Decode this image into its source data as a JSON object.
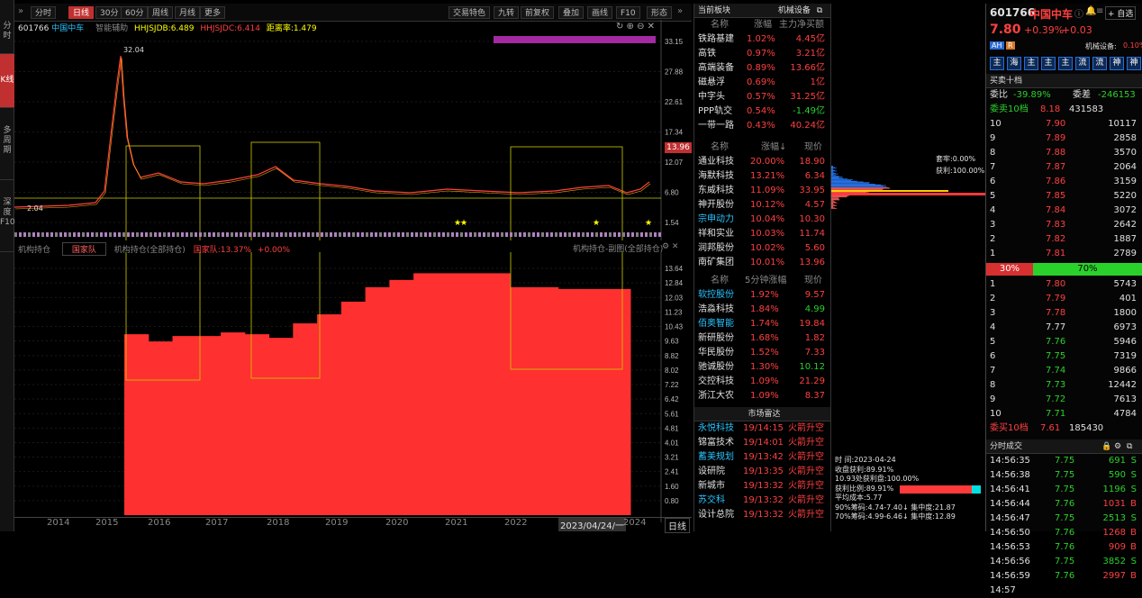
{
  "left_tabs": [
    "分时",
    "K线",
    "多周期",
    "深度F10"
  ],
  "toolbar": {
    "buttons": [
      "分时",
      "日线",
      "30分",
      "60分",
      "周线",
      "月线",
      "更多"
    ],
    "right_buttons": [
      "交易特色",
      "九转",
      "前复权",
      "叠加",
      "画线",
      "F10",
      "形态"
    ]
  },
  "chart": {
    "code": "601766",
    "name": "中国中车",
    "indicator": "智能辅助",
    "hhjsjdb": "HHJSJDB:6.489",
    "hhjsjdc": "HHJSJDC:6.414",
    "distance": "距离率:1.479",
    "price_axis": [
      "33.15",
      "27.88",
      "22.61",
      "17.34",
      "12.07",
      "6.80",
      "1.54"
    ],
    "current_price_tag": "13.96",
    "high_label": "32.04",
    "low_label": "2.04",
    "sub_title": "机构持仓",
    "sub_select": "国家队",
    "sub_indicator": "机构持仓(全部持仓)",
    "sub_value": "国家队:13.37%",
    "sub_change": "+0.00%",
    "sub_right": "机构持仓-副图(全部持仓)",
    "sub_axis": [
      "13.64",
      "12.84",
      "12.03",
      "11.23",
      "10.43",
      "9.63",
      "8.82",
      "8.02",
      "7.22",
      "6.42",
      "5.61",
      "4.81",
      "4.01",
      "3.21",
      "2.41",
      "1.60",
      "0.80"
    ],
    "x_years": [
      "2014",
      "2015",
      "2016",
      "2017",
      "2018",
      "2019",
      "2020",
      "2021",
      "2022",
      "2023/04/24/一",
      "2024"
    ],
    "period_button": "日线"
  },
  "chart_data": {
    "type": "bar",
    "title": "机构持仓",
    "series": [
      {
        "name": "国家队",
        "values": [
          10.0,
          9.6,
          9.9,
          9.9,
          10.1,
          10.0,
          9.8,
          10.6,
          11.1,
          11.8,
          12.6,
          13.0,
          13.37,
          13.37,
          13.37,
          13.37,
          12.6,
          12.6,
          12.5,
          12.5,
          12.5
        ]
      }
    ],
    "ylim": [
      0,
      13.64
    ]
  },
  "sector": {
    "title": "当前板块",
    "related": "机械设备",
    "headers": [
      "名称",
      "涨幅",
      "主力净买额"
    ],
    "rows": [
      {
        "name": "铁路基建",
        "pct": "1.02%",
        "net": "4.45亿"
      },
      {
        "name": "高铁",
        "pct": "0.97%",
        "net": "3.21亿"
      },
      {
        "name": "高端装备",
        "pct": "0.89%",
        "net": "13.66亿"
      },
      {
        "name": "磁悬浮",
        "pct": "0.69%",
        "net": "1亿"
      },
      {
        "name": "中字头",
        "pct": "0.57%",
        "net": "31.25亿"
      },
      {
        "name": "PPP轨交",
        "pct": "0.54%",
        "net": "-1.49亿"
      },
      {
        "name": "一带一路",
        "pct": "0.43%",
        "net": "40.24亿"
      }
    ]
  },
  "gainers": {
    "headers": [
      "名称",
      "涨幅↓",
      "现价"
    ],
    "rows": [
      {
        "name": "通业科技",
        "pct": "20.00%",
        "price": "18.90"
      },
      {
        "name": "海默科技",
        "pct": "13.21%",
        "price": "6.34"
      },
      {
        "name": "东威科技",
        "pct": "11.09%",
        "price": "33.95"
      },
      {
        "name": "神开股份",
        "pct": "10.12%",
        "price": "4.57"
      },
      {
        "name": "宗申动力",
        "pct": "10.04%",
        "price": "10.30"
      },
      {
        "name": "祥和实业",
        "pct": "10.03%",
        "price": "11.74"
      },
      {
        "name": "润邦股份",
        "pct": "10.02%",
        "price": "5.60"
      },
      {
        "name": "南矿集团",
        "pct": "10.01%",
        "price": "13.96"
      }
    ]
  },
  "five_min": {
    "headers": [
      "名称",
      "5分钟涨幅",
      "现价"
    ],
    "rows": [
      {
        "name": "软控股份",
        "pct": "1.92%",
        "price": "9.57"
      },
      {
        "name": "浩淼科技",
        "pct": "1.84%",
        "price": "4.99"
      },
      {
        "name": "佰奥智能",
        "pct": "1.74%",
        "price": "19.84"
      },
      {
        "name": "新研股份",
        "pct": "1.68%",
        "price": "1.82"
      },
      {
        "name": "华民股份",
        "pct": "1.52%",
        "price": "7.33"
      },
      {
        "name": "驰诚股份",
        "pct": "1.30%",
        "price": "10.12"
      },
      {
        "name": "交控科技",
        "pct": "1.09%",
        "price": "21.29"
      },
      {
        "name": "浙江大农",
        "pct": "1.09%",
        "price": "8.37"
      }
    ]
  },
  "radar": {
    "title": "市场雷达",
    "rows": [
      {
        "name": "永悦科技",
        "time": "19/14:15",
        "event": "火箭升空"
      },
      {
        "name": "锦富技术",
        "time": "19/14:01",
        "event": "火箭升空"
      },
      {
        "name": "蓄美规划",
        "time": "19/13:42",
        "event": "火箭升空"
      },
      {
        "name": "设研院",
        "time": "19/13:35",
        "event": "火箭升空"
      },
      {
        "name": "新城市",
        "time": "19/13:32",
        "event": "火箭升空"
      },
      {
        "name": "苏交科",
        "time": "19/13:32",
        "event": "火箭升空"
      },
      {
        "name": "设计总院",
        "time": "19/13:32",
        "event": "火箭升空"
      }
    ]
  },
  "depth": {
    "top_label": "套牢:0.00%",
    "profit_label": "获利:100.00%",
    "time": "时 间:2023-04-24",
    "profit_ratio": "收盘获利:89.91%",
    "cost_line": "10.93处获利盘:100.00%",
    "profit_ratio2": "获利比例:89.91%",
    "avg_cost": "平均成本:5.77",
    "range90": "90%筹码:4.74-7.40↓ 集中度:21.87",
    "range70": "70%筹码:4.99-6.46↓ 集中度:12.89"
  },
  "quote": {
    "code": "601766",
    "name": "中国中车",
    "price": "7.80",
    "change": "+0.39%",
    "change_amt": "+0.03",
    "tags": [
      "AH",
      "R"
    ],
    "sector_tag": "机械设备:",
    "sector_pct": "0.10%",
    "nav_icons": [
      "主",
      "海",
      "主",
      "主",
      "主",
      "流",
      "流",
      "神",
      "神"
    ],
    "book_title": "买卖十档",
    "weibi_label": "委比",
    "weibi": "-39.89%",
    "weicha_label": "委差",
    "weicha": "-246153",
    "sell10_label": "委卖10档",
    "sell10_price": "8.18",
    "sell10_vol": "431583",
    "asks": [
      {
        "lvl": "10",
        "price": "7.90",
        "vol": "10117"
      },
      {
        "lvl": "9",
        "price": "7.89",
        "vol": "2858"
      },
      {
        "lvl": "8",
        "price": "7.88",
        "vol": "3570"
      },
      {
        "lvl": "7",
        "price": "7.87",
        "vol": "2064"
      },
      {
        "lvl": "6",
        "price": "7.86",
        "vol": "3159"
      },
      {
        "lvl": "5",
        "price": "7.85",
        "vol": "5220"
      },
      {
        "lvl": "4",
        "price": "7.84",
        "vol": "3072"
      },
      {
        "lvl": "3",
        "price": "7.83",
        "vol": "2642"
      },
      {
        "lvl": "2",
        "price": "7.82",
        "vol": "1887"
      },
      {
        "lvl": "1",
        "price": "7.81",
        "vol": "2789"
      }
    ],
    "ratio_sell": "30%",
    "ratio_buy": "70%",
    "ratio_buy_fraction": 0.7,
    "bids": [
      {
        "lvl": "1",
        "price": "7.80",
        "vol": "5743"
      },
      {
        "lvl": "2",
        "price": "7.79",
        "vol": "401"
      },
      {
        "lvl": "3",
        "price": "7.78",
        "vol": "1800"
      },
      {
        "lvl": "4",
        "price": "7.77",
        "vol": "6973"
      },
      {
        "lvl": "5",
        "price": "7.76",
        "vol": "5946"
      },
      {
        "lvl": "6",
        "price": "7.75",
        "vol": "7319"
      },
      {
        "lvl": "7",
        "price": "7.74",
        "vol": "9866"
      },
      {
        "lvl": "8",
        "price": "7.73",
        "vol": "12442"
      },
      {
        "lvl": "9",
        "price": "7.72",
        "vol": "7613"
      },
      {
        "lvl": "10",
        "price": "7.71",
        "vol": "4784"
      }
    ],
    "buy10_label": "委买10档",
    "buy10_price": "7.61",
    "buy10_vol": "185430",
    "ticks_title": "分时成交",
    "ticks": [
      {
        "time": "14:56:35",
        "price": "7.75",
        "vol": "691",
        "dir": "S"
      },
      {
        "time": "14:56:38",
        "price": "7.75",
        "vol": "590",
        "dir": "S"
      },
      {
        "time": "14:56:41",
        "price": "7.75",
        "vol": "1196",
        "dir": "S"
      },
      {
        "time": "14:56:44",
        "price": "7.76",
        "vol": "1031",
        "dir": "B"
      },
      {
        "time": "14:56:47",
        "price": "7.75",
        "vol": "2513",
        "dir": "S"
      },
      {
        "time": "14:56:50",
        "price": "7.76",
        "vol": "1268",
        "dir": "B"
      },
      {
        "time": "14:56:53",
        "price": "7.76",
        "vol": "909",
        "dir": "B"
      },
      {
        "time": "14:56:56",
        "price": "7.75",
        "vol": "3852",
        "dir": "S"
      },
      {
        "time": "14:56:59",
        "price": "7.76",
        "vol": "2997",
        "dir": "B"
      },
      {
        "time": "14:57",
        "price": "",
        "vol": "",
        "dir": ""
      }
    ],
    "self_select": "+ 自选"
  }
}
